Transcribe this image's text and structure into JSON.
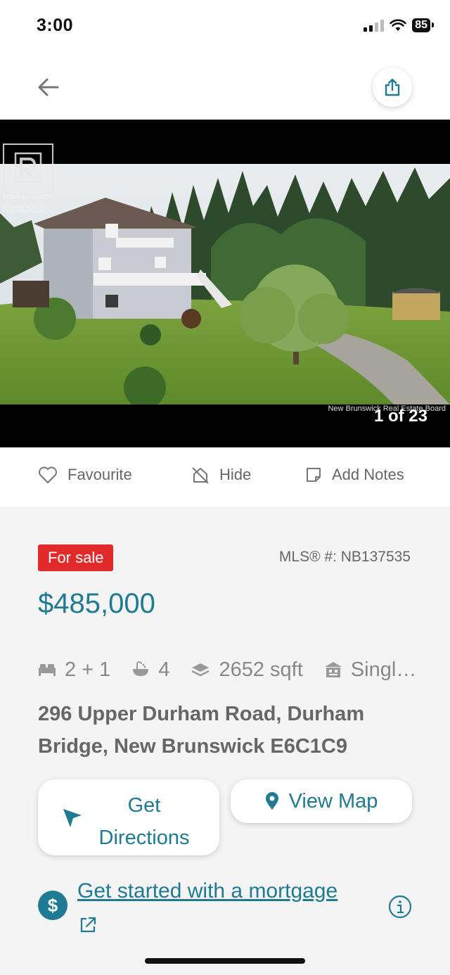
{
  "status": {
    "time": "3:00",
    "battery": "85"
  },
  "nav": {
    "back_icon": "arrow-left-icon",
    "share_icon": "share-icon"
  },
  "photo": {
    "realtor_text_1": "REALTOR®",
    "realtor_text_2": "REALTOR",
    "board": "New Brunswick Real Estate Board",
    "count": "1 of 23"
  },
  "actions": {
    "favourite": "Favourite",
    "hide": "Hide",
    "notes": "Add Notes"
  },
  "listing": {
    "status": "For sale",
    "mls": "MLS® #: NB137535",
    "price": "$485,000",
    "beds": "2 + 1",
    "baths": "4",
    "sqft": "2652 sqft",
    "type": "Singl…",
    "address": "296 Upper Durham Road, Durham Bridge, New Brunswick E6C1C9"
  },
  "buttons": {
    "directions_1": "Get",
    "directions_2": "Directions",
    "map": "View Map"
  },
  "mortgage": {
    "link": "Get started with a mortgage",
    "symbol": "$"
  },
  "colors": {
    "accent": "#1f7a94",
    "badge": "#e32a2b",
    "background": "#f4f4f4"
  }
}
